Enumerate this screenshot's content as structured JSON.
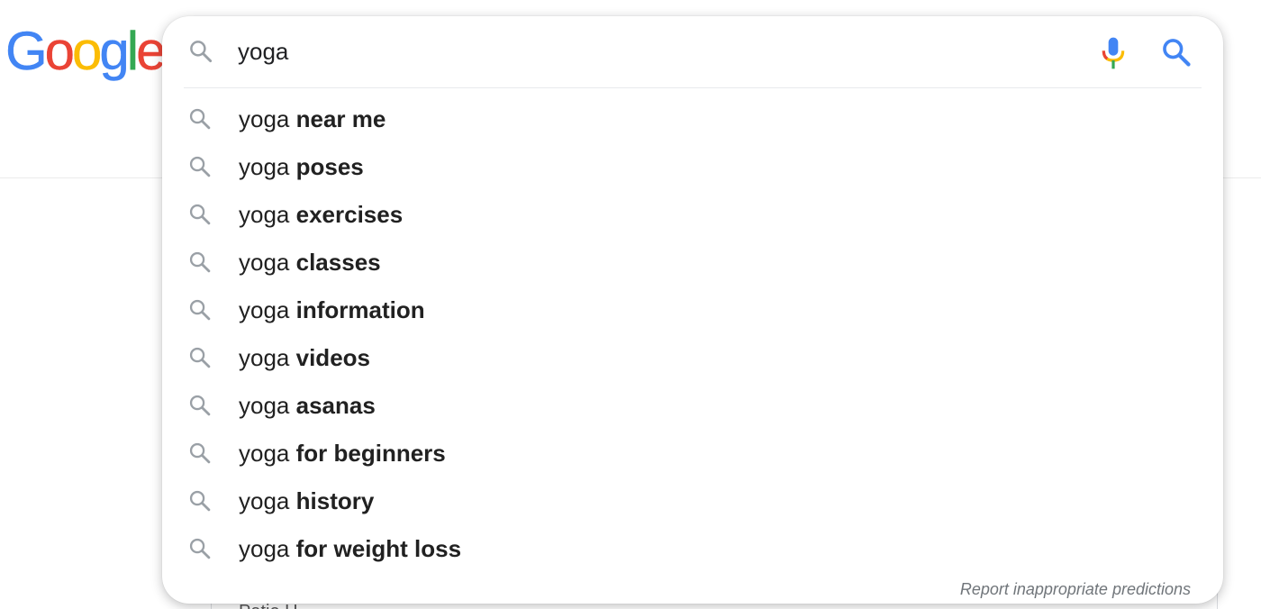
{
  "logo": {
    "letters": [
      "G",
      "o",
      "o",
      "g",
      "l",
      "e"
    ],
    "colors": [
      "#4285F4",
      "#EA4335",
      "#FBBC05",
      "#4285F4",
      "#34A853",
      "#EA4335"
    ]
  },
  "search": {
    "query": "yoga",
    "lead_icon": "search-icon",
    "mic_icon": "microphone-icon",
    "submit_icon": "search-icon",
    "accent": "#4285F4"
  },
  "suggestions": [
    {
      "prefix": "yoga",
      "completion": "near me",
      "icon": "search-icon"
    },
    {
      "prefix": "yoga",
      "completion": "poses",
      "icon": "search-icon"
    },
    {
      "prefix": "yoga",
      "completion": "exercises",
      "icon": "search-icon"
    },
    {
      "prefix": "yoga",
      "completion": "classes",
      "icon": "search-icon"
    },
    {
      "prefix": "yoga",
      "completion": "information",
      "icon": "search-icon"
    },
    {
      "prefix": "yoga",
      "completion": "videos",
      "icon": "search-icon"
    },
    {
      "prefix": "yoga",
      "completion": "asanas",
      "icon": "search-icon"
    },
    {
      "prefix": "yoga",
      "completion": "for beginners",
      "icon": "search-icon"
    },
    {
      "prefix": "yoga",
      "completion": "history",
      "icon": "search-icon"
    },
    {
      "prefix": "yoga",
      "completion": "for weight loss",
      "icon": "search-icon"
    }
  ],
  "report_link": "Report inappropriate predictions",
  "background_partial_text": "Patie      H"
}
